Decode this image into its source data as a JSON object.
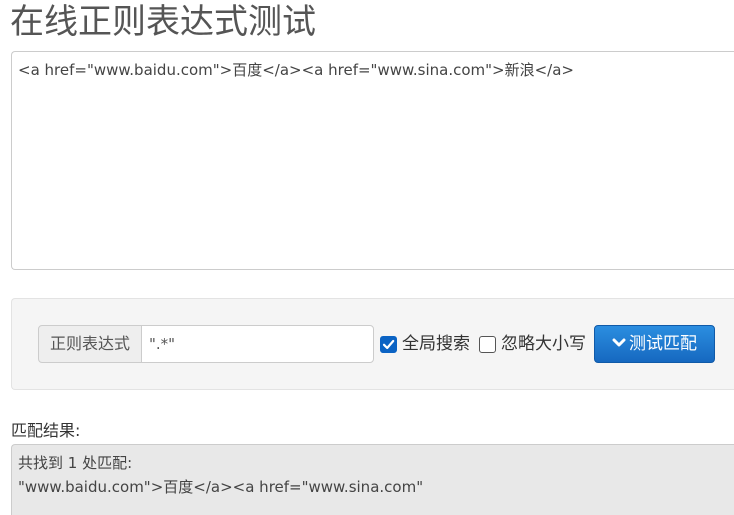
{
  "page": {
    "title": "在线正则表达式测试"
  },
  "source": {
    "text": "<a href=\"www.baidu.com\">百度</a><a href=\"www.sina.com\">新浪</a>"
  },
  "regex_form": {
    "addon_label": "正则表达式",
    "input_value": "\".*\"",
    "global_search": {
      "label": "全局搜索",
      "checked": true
    },
    "ignore_case": {
      "label": "忽略大小写",
      "checked": false
    },
    "test_button_label": "测试匹配",
    "test_button_icon": "chevron-down-icon"
  },
  "result": {
    "label": "匹配结果:",
    "summary": "共找到 1 处匹配:",
    "match": "\"www.baidu.com\">百度</a><a href=\"www.sina.com\""
  },
  "colors": {
    "button_primary": "#1668c0",
    "checkbox_checked": "#0b63c4",
    "result_background": "#e8e8e8"
  }
}
